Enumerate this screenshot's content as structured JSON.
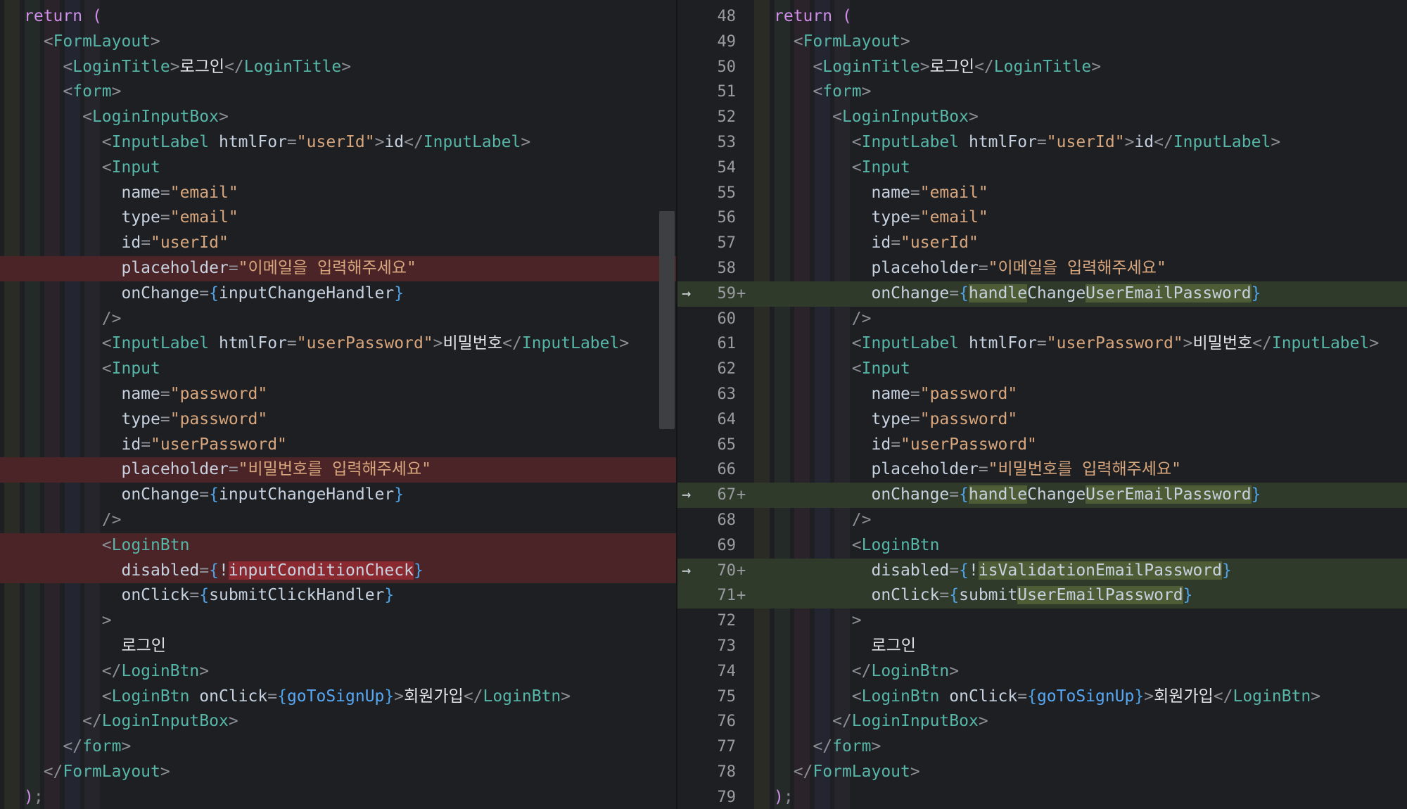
{
  "left": {
    "lines": [
      "return (",
      "  <FormLayout>",
      "    <LoginTitle>로그인</LoginTitle>",
      "    <form>",
      "      <LoginInputBox>",
      "        <InputLabel htmlFor=\"userId\">id</InputLabel>",
      "        <Input",
      "          name=\"email\"",
      "          type=\"email\"",
      "          id=\"userId\"",
      "          placeholder=\"이메일을 입력해주세요\"",
      "          onChange={inputChangeHandler}",
      "        />",
      "        <InputLabel htmlFor=\"userPassword\">비밀번호</InputLabel>",
      "        <Input",
      "          name=\"password\"",
      "          type=\"password\"",
      "          id=\"userPassword\"",
      "          placeholder=\"비밀번호를 입력해주세요\"",
      "          onChange={inputChangeHandler}",
      "        />",
      "        <LoginBtn",
      "          disabled={!inputConditionCheck}",
      "          onClick={submitClickHandler}",
      "        >",
      "          로그인",
      "        </LoginBtn>",
      "        <LoginBtn onClick={goToSignUp}>회원가입</LoginBtn>",
      "      </LoginInputBox>",
      "    </form>",
      "  </FormLayout>",
      ");"
    ],
    "removed_rows": [
      10,
      18,
      21,
      22
    ]
  },
  "right": {
    "line_numbers": [
      "48",
      "49",
      "50",
      "51",
      "52",
      "53",
      "54",
      "55",
      "56",
      "57",
      "58",
      "59",
      "60",
      "61",
      "62",
      "63",
      "64",
      "65",
      "66",
      "67",
      "68",
      "69",
      "70",
      "71",
      "72",
      "73",
      "74",
      "75",
      "76",
      "77",
      "78",
      "79"
    ],
    "lines": [
      "return (",
      "  <FormLayout>",
      "    <LoginTitle>로그인</LoginTitle>",
      "    <form>",
      "      <LoginInputBox>",
      "        <InputLabel htmlFor=\"userId\">id</InputLabel>",
      "        <Input",
      "          name=\"email\"",
      "          type=\"email\"",
      "          id=\"userId\"",
      "          placeholder=\"이메일을 입력해주세요\"",
      "          onChange={handleChangeUserEmailPassword}",
      "        />",
      "        <InputLabel htmlFor=\"userPassword\">비밀번호</InputLabel>",
      "        <Input",
      "          name=\"password\"",
      "          type=\"password\"",
      "          id=\"userPassword\"",
      "          placeholder=\"비밀번호를 입력해주세요\"",
      "          onChange={handleChangeUserEmailPassword}",
      "        />",
      "        <LoginBtn",
      "          disabled={!isValidationEmailPassword}",
      "          onClick={submitUserEmailPassword}",
      "        >",
      "          로그인",
      "        </LoginBtn>",
      "        <LoginBtn onClick={goToSignUp}>회원가입</LoginBtn>",
      "      </LoginInputBox>",
      "    </form>",
      "  </FormLayout>",
      ");"
    ],
    "added_rows": [
      11,
      19,
      22,
      23
    ],
    "arrow_rows": [
      11,
      19,
      22
    ],
    "arrow_glyph": "→",
    "added_marker": "+"
  },
  "colors": {
    "background": "#1e1f22",
    "removed_line": "#4a2426",
    "removed_highlight": "#8a2a30",
    "added_line": "#2f3a2a",
    "added_highlight": "#4e5d36"
  }
}
